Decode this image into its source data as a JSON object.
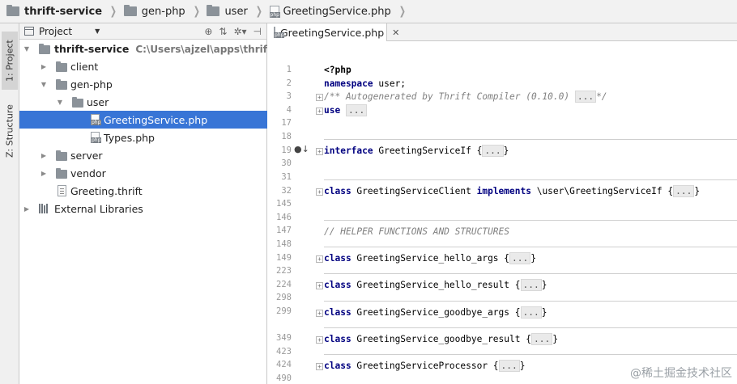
{
  "breadcrumb": {
    "items": [
      {
        "label": "thrift-service",
        "bold": true,
        "icon": "folder-icon"
      },
      {
        "label": "gen-php",
        "bold": false,
        "icon": "folder-icon"
      },
      {
        "label": "user",
        "bold": false,
        "icon": "folder-icon"
      },
      {
        "label": "GreetingService.php",
        "bold": false,
        "icon": "php-file-icon"
      }
    ]
  },
  "toolstrip": {
    "project_tab": "1: Project",
    "structure_tab": "Z: Structure"
  },
  "project_panel": {
    "title": "Project",
    "tree": [
      {
        "label": "thrift-service",
        "path": "C:\\Users\\ajzel\\apps\\thrift-service",
        "icon": "folder-icon",
        "expanded": true
      },
      {
        "label": "client",
        "icon": "folder-icon",
        "expanded": false
      },
      {
        "label": "gen-php",
        "icon": "folder-icon",
        "expanded": true
      },
      {
        "label": "user",
        "icon": "folder-icon",
        "expanded": true
      },
      {
        "label": "GreetingService.php",
        "icon": "php-file-icon",
        "selected": true
      },
      {
        "label": "Types.php",
        "icon": "php-file-icon"
      },
      {
        "label": "server",
        "icon": "folder-icon",
        "expanded": false
      },
      {
        "label": "vendor",
        "icon": "folder-icon",
        "expanded": false
      },
      {
        "label": "Greeting.thrift",
        "icon": "file-icon"
      },
      {
        "label": "External Libraries",
        "icon": "library-icon",
        "expanded": false
      }
    ]
  },
  "editor": {
    "tab_label": "GreetingService.php",
    "line_numbers": [
      "1",
      "2",
      "3",
      "4",
      "17",
      "18",
      "19",
      "30",
      "31",
      "32",
      "145",
      "146",
      "147",
      "148",
      "149",
      "223",
      "224",
      "298",
      "299",
      "349",
      "423",
      "424",
      "490"
    ],
    "code": {
      "php_open": "<?php",
      "ns_kw": "namespace",
      "ns_rest": " user;",
      "comment_start": "/** Autogenerated by Thrift Compiler (0.10.0) ",
      "comment_end": "*/",
      "use_kw": "use",
      "fold": "...",
      "interface_kw": "interface",
      "interface_name": " GreetingServiceIf {",
      "class_kw": "class",
      "client_name": " GreetingServiceClient ",
      "implements_kw": "implements",
      "client_iface": " \\user\\GreetingServiceIf {",
      "helper_comment": "// HELPER FUNCTIONS AND STRUCTURES",
      "hello_args": " GreetingService_hello_args {",
      "hello_result": " GreetingService_hello_result {",
      "goodbye_args": " GreetingService_goodbye_args {",
      "goodbye_result": " GreetingService_goodbye_result {",
      "processor": " GreetingServiceProcessor {",
      "close_brace": "}"
    }
  },
  "watermark": "@稀土掘金技术社区"
}
